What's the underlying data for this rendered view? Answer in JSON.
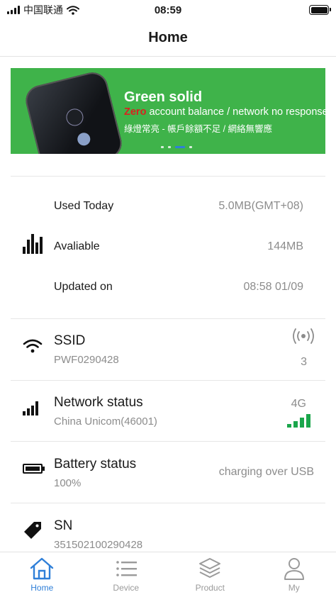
{
  "status_bar": {
    "carrier": "中国联通",
    "time": "08:59"
  },
  "nav": {
    "title": "Home"
  },
  "banner": {
    "title": "Green solid",
    "zero": "Zero",
    "line1_rest": " account balance / network no response",
    "line2": "綠燈常亮 - 帳戶餘額不足 / 網絡無響應",
    "page_count": 4,
    "active_page": 3
  },
  "usage": {
    "used_today_label": "Used Today",
    "used_today_value": "5.0MB(GMT+08)",
    "available_label": "Avaliable",
    "available_value": "144MB",
    "updated_label": "Updated on",
    "updated_value": "08:58 01/09"
  },
  "ssid": {
    "title": "SSID",
    "value": "PWF0290428",
    "clients": "3"
  },
  "network": {
    "title": "Network status",
    "value": "China Unicom(46001)",
    "type": "4G",
    "accent": "#1aa64b"
  },
  "battery": {
    "title": "Battery status",
    "value": "100%",
    "state": "charging over USB"
  },
  "sn": {
    "title": "SN",
    "value": "351502100290428"
  },
  "tabs": [
    {
      "label": "Home",
      "icon": "home-icon",
      "active": true
    },
    {
      "label": "Device",
      "icon": "list-icon",
      "active": false
    },
    {
      "label": "Product",
      "icon": "layers-icon",
      "active": false
    },
    {
      "label": "My",
      "icon": "user-icon",
      "active": false
    }
  ],
  "colors": {
    "accent": "#2f7fd8",
    "banner": "#3fb34a"
  }
}
